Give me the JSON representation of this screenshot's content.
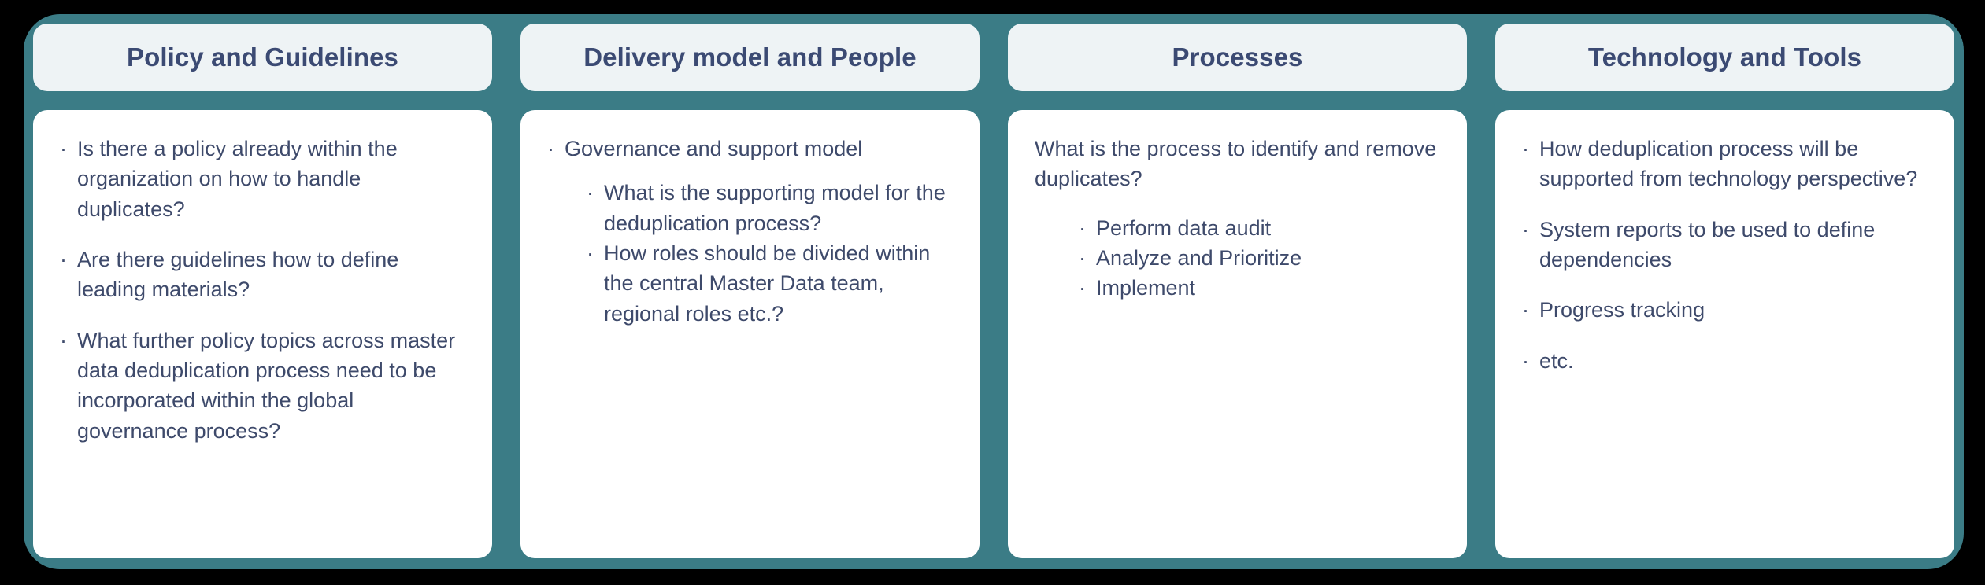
{
  "theme": {
    "backdrop": "#000000",
    "slab_teal": "#3b7c86",
    "header_fill": "#eef3f5",
    "header_text": "#3b4a73",
    "body_fill": "#ffffff",
    "body_text": "#3e4a6b",
    "bullet_glyph": "·"
  },
  "columns": [
    {
      "title": "Policy and Guidelines",
      "lead": null,
      "bullets": [
        "Is there a policy already within the organization on how to handle duplicates?",
        "Are there guidelines how to define leading materials?",
        "What further policy topics across master data deduplication process need to be incorporated within the global governance process?"
      ],
      "sub_bullets": []
    },
    {
      "title": "Delivery model and People",
      "lead": null,
      "bullets": [
        "Governance and support model"
      ],
      "sub_bullets": [
        "What is the supporting model for the deduplication process?",
        "How roles should be divided within the central Master Data team, regional roles etc.?"
      ]
    },
    {
      "title": "Processes",
      "lead": "What is the process to identify and remove duplicates?",
      "bullets": [],
      "sub_bullets": [
        "Perform data audit",
        "Analyze and Prioritize",
        "Implement"
      ]
    },
    {
      "title": "Technology and Tools",
      "lead": null,
      "bullets": [
        "How deduplication process will be supported from technology perspective?",
        "System reports to be used to define dependencies",
        "Progress tracking",
        "etc."
      ],
      "sub_bullets": []
    }
  ]
}
